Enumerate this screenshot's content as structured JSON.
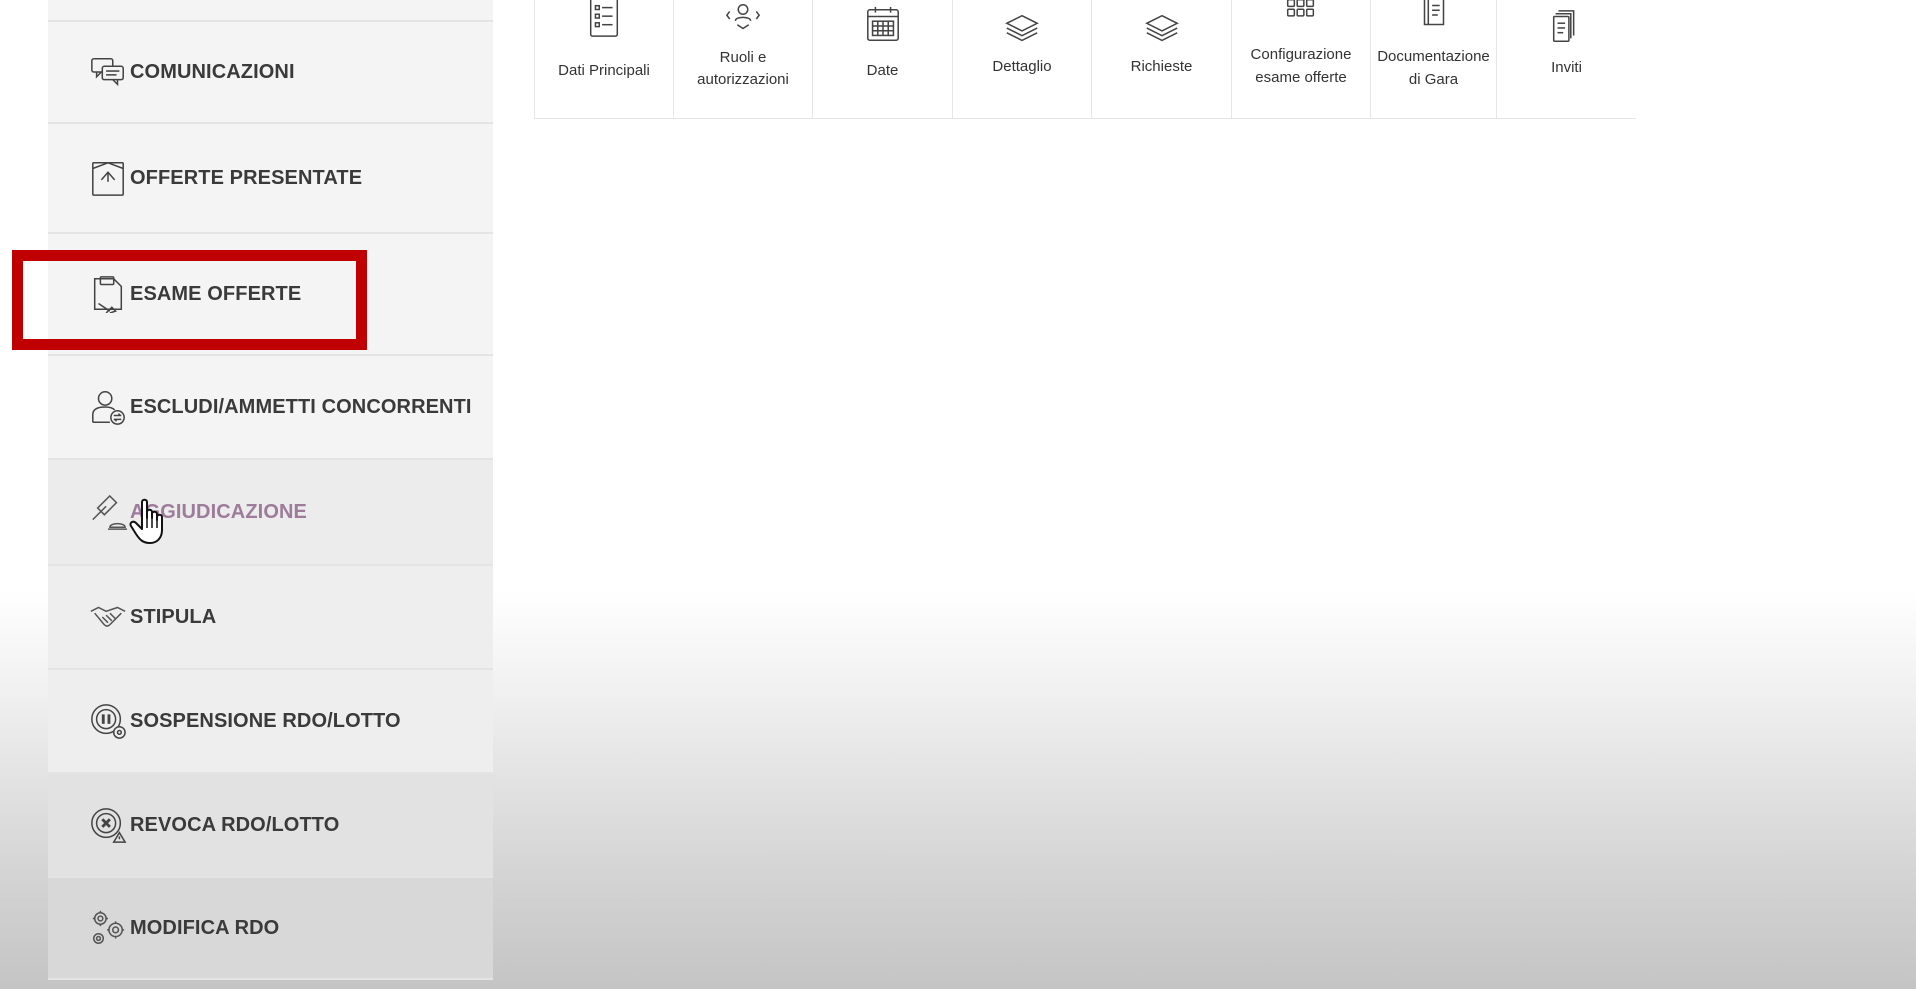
{
  "sidebar": {
    "items": [
      {
        "label": "COMUNICAZIONI",
        "icon": "chat-bubbles-icon"
      },
      {
        "label": "OFFERTE PRESENTATE",
        "icon": "envelope-icon"
      },
      {
        "label": "ESAME OFFERTE",
        "icon": "document-pen-icon"
      },
      {
        "label": "ESCLUDI/AMMETTI CONCORRENTI",
        "icon": "user-switch-icon"
      },
      {
        "label": "AGGIUDICAZIONE",
        "icon": "gavel-icon"
      },
      {
        "label": "STIPULA",
        "icon": "handshake-icon"
      },
      {
        "label": "SOSPENSIONE RDO/LOTTO",
        "icon": "pause-clock-icon"
      },
      {
        "label": "REVOCA RDO/LOTTO",
        "icon": "cancel-warning-icon"
      },
      {
        "label": "MODIFICA RDO",
        "icon": "gears-icon"
      }
    ],
    "hovered_item": "AGGIUDICAZIONE",
    "highlighted_item": "ESAME OFFERTE"
  },
  "tabs": [
    {
      "line1": "Dati Principali",
      "line2": "",
      "icon": "checklist-icon"
    },
    {
      "line1": "Ruoli e",
      "line2": "autorizzazioni",
      "icon": "users-icon"
    },
    {
      "line1": "Date",
      "line2": "",
      "icon": "calendar-icon"
    },
    {
      "line1": "Dettaglio",
      "line2": "",
      "icon": "layers-icon"
    },
    {
      "line1": "Richieste",
      "line2": "",
      "icon": "layers-icon"
    },
    {
      "line1": "Configurazione",
      "line2": "esame offerte",
      "icon": "grid-icon"
    },
    {
      "line1": "Documentazione",
      "line2": "di Gara",
      "icon": "document-icon"
    },
    {
      "line1": "Inviti",
      "line2": "",
      "icon": "documents-stack-icon"
    }
  ],
  "colors": {
    "highlight": "#c00000",
    "hover_text": "#9d7b9b",
    "menu_text": "#3a3a3a"
  }
}
